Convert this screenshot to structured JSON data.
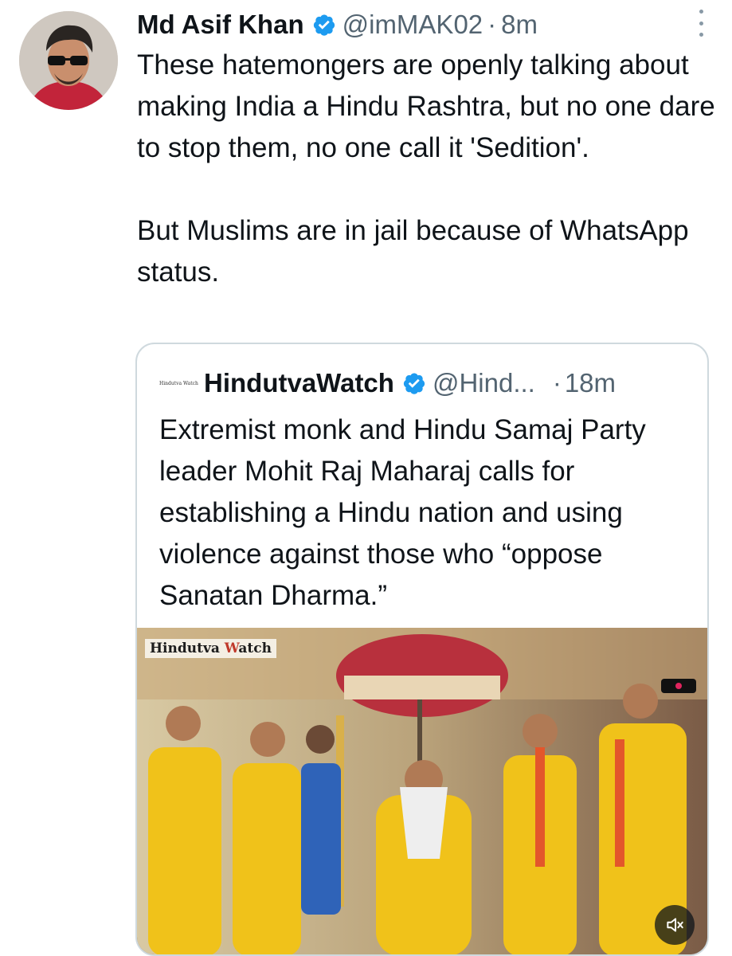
{
  "tweet": {
    "author": {
      "name": "Md Asif Khan",
      "handle": "@imMAK02",
      "avatar_icon": "profile-avatar"
    },
    "separator": "·",
    "time": "8m",
    "text_paragraphs": [
      "These hatemongers are openly talking about making India a Hindu Rashtra, but no one dare to stop them, no one call it 'Sedition'.",
      "But Muslims are in jail because of WhatsApp status."
    ],
    "more_icon": "more-vertical-icon"
  },
  "quoted_tweet": {
    "author": {
      "name": "HindutvaWatch",
      "handle": "@Hind...",
      "logo_text": "Hindutva Watch"
    },
    "separator": "·",
    "time": "18m",
    "text": "Extremist monk and Hindu Samaj Party leader Mohit Raj Maharaj calls for establishing a Hindu nation and using violence against those who “oppose Sanatan Dharma.”",
    "media": {
      "type": "video",
      "watermark_part1": "Hindutva ",
      "watermark_accent": "W",
      "watermark_part2": "atch",
      "mute_icon": "muted-speaker-icon"
    }
  },
  "colors": {
    "text": "#0f1419",
    "secondary": "#536471",
    "verified": "#1d9bf0",
    "border": "#cfd9de"
  }
}
